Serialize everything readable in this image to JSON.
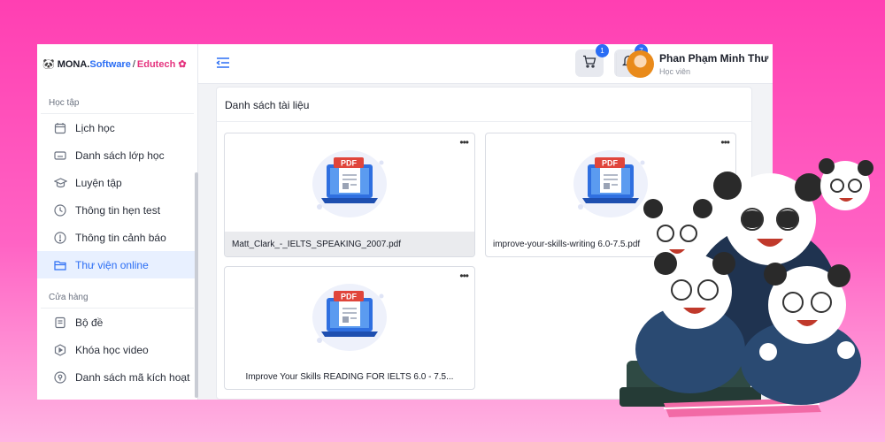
{
  "brand": {
    "part1": "MONA.",
    "part2": "Software",
    "sep": "/",
    "part3": "Edutech"
  },
  "sidebar": {
    "section1": "Học tập",
    "items1": [
      {
        "label": "Lịch học",
        "icon": "calendar-icon"
      },
      {
        "label": "Danh sách lớp học",
        "icon": "keyboard-icon"
      },
      {
        "label": "Luyện tập",
        "icon": "graduation-cap-icon"
      },
      {
        "label": "Thông tin hẹn test",
        "icon": "clock-icon"
      },
      {
        "label": "Thông tin cảnh báo",
        "icon": "warning-icon"
      },
      {
        "label": "Thư viện online",
        "icon": "folder-icon",
        "active": true
      }
    ],
    "section2": "Cửa hàng",
    "items2": [
      {
        "label": "Bộ đề",
        "icon": "document-icon"
      },
      {
        "label": "Khóa học video",
        "icon": "video-icon"
      },
      {
        "label": "Danh sách mã kích hoạt",
        "icon": "key-icon"
      }
    ]
  },
  "header": {
    "cart_count": "1",
    "notification_count": "7",
    "user_name": "Phan Phạm Minh Thư",
    "user_role": "Học viên"
  },
  "main": {
    "title": "Danh sách tài liệu",
    "pdf_label": "PDF",
    "documents": [
      {
        "name": "Matt_Clark_-_IELTS_SPEAKING_2007.pdf"
      },
      {
        "name": "improve-your-skills-writing 6.0-7.5.pdf"
      },
      {
        "name": "Improve Your Skills READING FOR IELTS 6.0 - 7.5..."
      }
    ]
  },
  "colors": {
    "accent": "#2a6df4",
    "pink": "#e5337e",
    "pdf_red": "#e0453b"
  }
}
